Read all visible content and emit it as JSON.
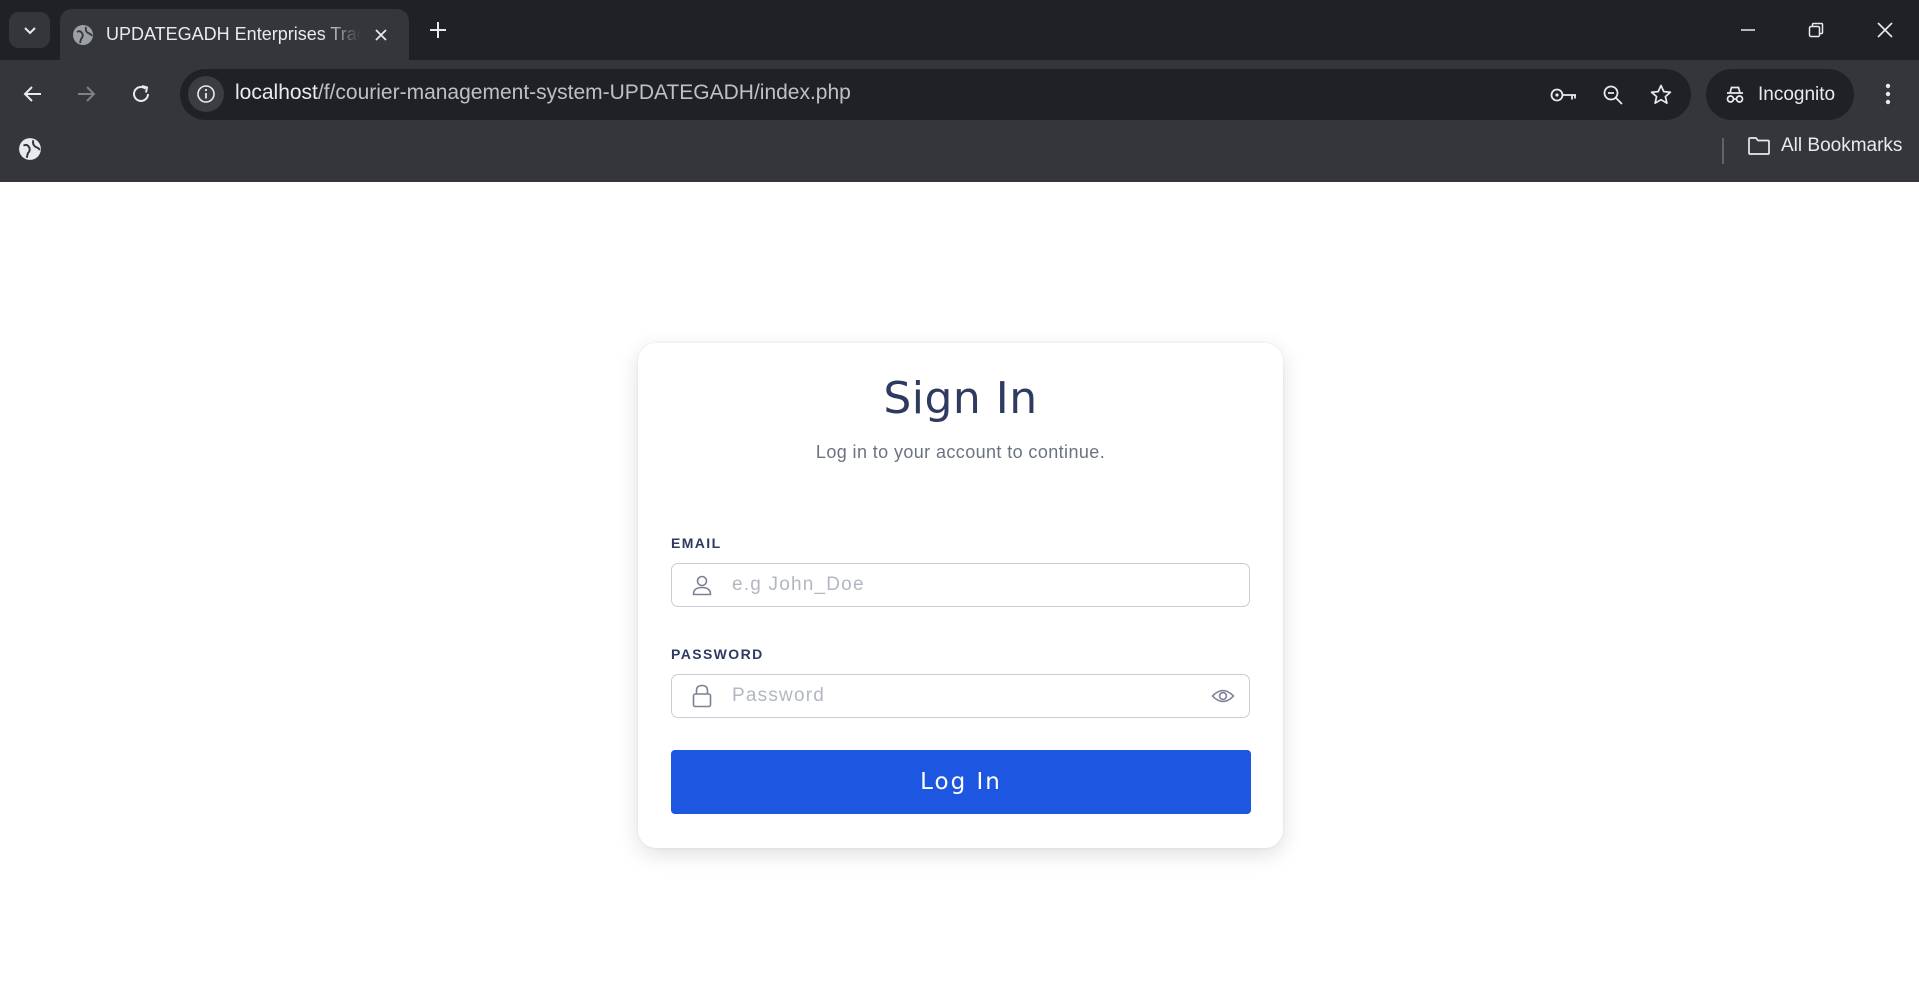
{
  "browser": {
    "tab_title": "UPDATEGADH Enterprises Tracking",
    "url_host": "localhost",
    "url_path": "/f/courier-management-system-UPDATEGADH/index.php",
    "profile_label": "Incognito",
    "bookmarks_label": "All Bookmarks"
  },
  "signin": {
    "title": "Sign In",
    "subtitle": "Log in to your account to continue.",
    "email_label": "EMAIL",
    "email_placeholder": "e.g John_Doe",
    "password_label": "PASSWORD",
    "password_placeholder": "Password",
    "submit_label": "Log In"
  },
  "colors": {
    "primary": "#1d56e0",
    "heading": "#2f3a60",
    "chrome_dark": "#202124",
    "chrome_mid": "#35363a"
  }
}
